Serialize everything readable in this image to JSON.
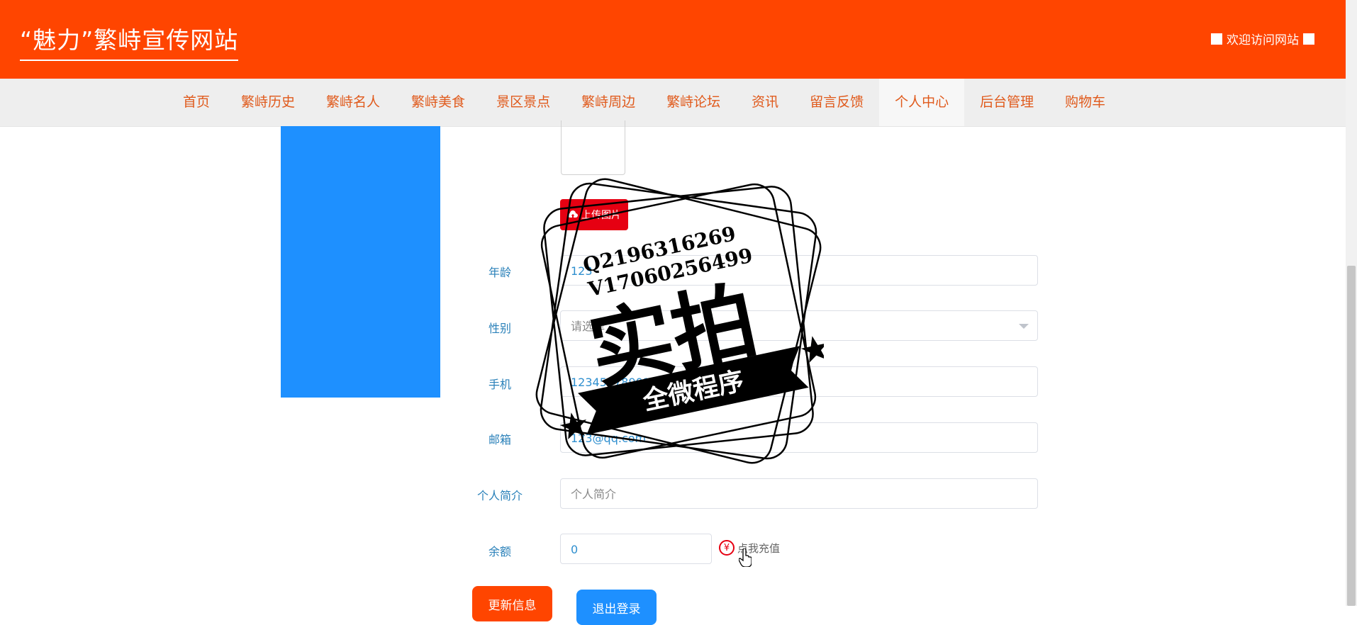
{
  "header": {
    "site_title": "“魅力”繁峙宣传网站",
    "welcome_text": "欢迎访问网站",
    "bg_color": "#ff4500"
  },
  "nav": {
    "items": [
      {
        "label": "首页"
      },
      {
        "label": "繁峙历史"
      },
      {
        "label": "繁峙名人"
      },
      {
        "label": "繁峙美食"
      },
      {
        "label": "景区景点"
      },
      {
        "label": "繁峙周边"
      },
      {
        "label": "繁峙论坛"
      },
      {
        "label": "资讯"
      },
      {
        "label": "留言反馈"
      },
      {
        "label": "个人中心"
      },
      {
        "label": "后台管理"
      },
      {
        "label": "购物车"
      }
    ],
    "active": "个人中心"
  },
  "form": {
    "upload_label": "上传图片",
    "age": {
      "label": "年龄",
      "value": "123"
    },
    "gender": {
      "label": "性别",
      "placeholder": "请选择"
    },
    "phone": {
      "label": "手机",
      "value": "12345678901"
    },
    "email": {
      "label": "邮箱",
      "value": "123@qq.com"
    },
    "bio": {
      "label": "个人简介",
      "placeholder": "个人简介"
    },
    "balance": {
      "label": "余额",
      "value": "0"
    },
    "recharge_label": "点我充值",
    "recharge_icon": "¥"
  },
  "buttons": {
    "update": "更新信息",
    "logout": "退出登录"
  },
  "watermark": {
    "line1": "Q2196316269",
    "line2": "V17060256499",
    "main": "实拍",
    "banner": "全微程序"
  }
}
